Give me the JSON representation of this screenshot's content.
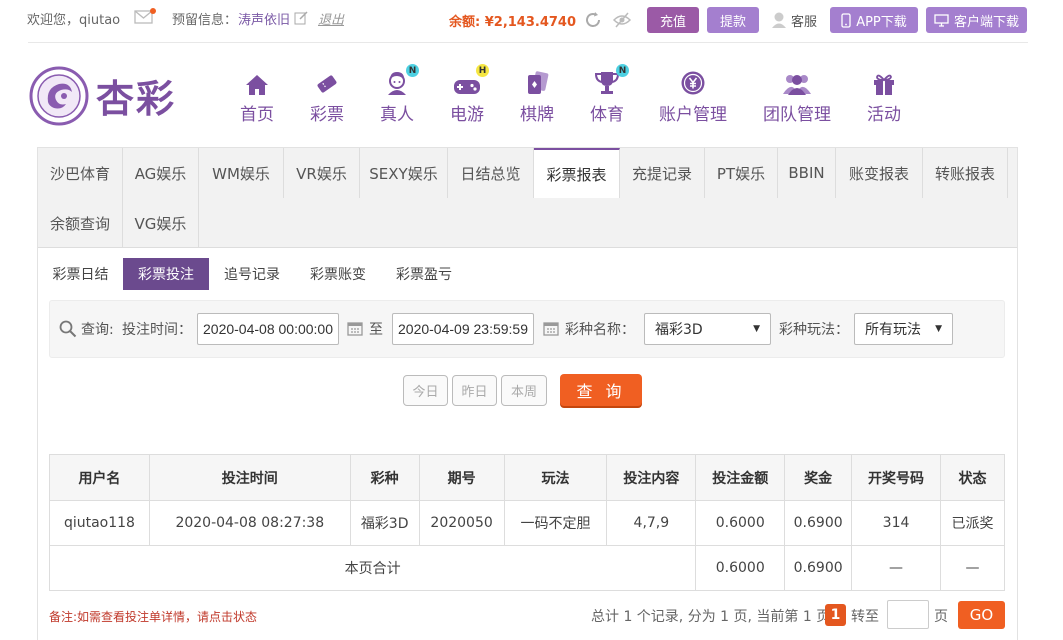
{
  "topbar": {
    "welcome": "欢迎您，qiutao",
    "reserved_label": "预留信息：",
    "reserved_value": "涛声依旧",
    "logout": "退出",
    "balance_label": "余额: ",
    "balance_value": "¥2,143.4740",
    "recharge": "充值",
    "withdraw": "提款",
    "service": "客服",
    "app_download": "APP下载",
    "client_download": "客户端下载"
  },
  "brand": {
    "name": "杏彩"
  },
  "nav": [
    {
      "label": "首页",
      "icon": "home-icon"
    },
    {
      "label": "彩票",
      "icon": "ticket-icon"
    },
    {
      "label": "真人",
      "icon": "live-dealer-icon",
      "badge": "N"
    },
    {
      "label": "电游",
      "icon": "gamepad-icon",
      "badge": "H"
    },
    {
      "label": "棋牌",
      "icon": "cards-icon"
    },
    {
      "label": "体育",
      "icon": "trophy-icon",
      "badge": "N"
    },
    {
      "label": "账户管理",
      "icon": "yen-coin-icon"
    },
    {
      "label": "团队管理",
      "icon": "team-icon"
    },
    {
      "label": "活动",
      "icon": "gift-icon"
    }
  ],
  "report_tabs": [
    "沙巴体育",
    "AG娱乐",
    "WM娱乐",
    "VR娱乐",
    "SEXY娱乐",
    "日结总览",
    "彩票报表",
    "充提记录",
    "PT娱乐",
    "BBIN",
    "账变报表",
    "转账报表",
    "余额查询",
    "VG娱乐"
  ],
  "active_report_tab": "彩票报表",
  "sub_tabs": [
    "彩票日结",
    "彩票投注",
    "追号记录",
    "彩票账变",
    "彩票盈亏"
  ],
  "active_sub_tab": "彩票投注",
  "query": {
    "label": "查询:",
    "bet_time_label": "投注时间：",
    "start": "2020-04-08 00:00:00",
    "to": "至",
    "end": "2020-04-09 23:59:59",
    "lottery_label": "彩种名称：",
    "lottery_value": "福彩3D",
    "play_label": "彩种玩法：",
    "play_value": "所有玩法",
    "today": "今日",
    "yesterday": "昨日",
    "this_week": "本周",
    "submit": "查 询"
  },
  "table": {
    "headers": [
      "用户名",
      "投注时间",
      "彩种",
      "期号",
      "玩法",
      "投注内容",
      "投注金额",
      "奖金",
      "开奖号码",
      "状态"
    ],
    "rows": [
      [
        "qiutao118",
        "2020-04-08 08:27:38",
        "福彩3D",
        "2020050",
        "一码不定胆",
        "4,7,9",
        "0.6000",
        "0.6900",
        "314",
        "已派奖"
      ]
    ],
    "total_label": "本页合计",
    "total_amount": "0.6000",
    "total_bonus": "0.6900",
    "total_dash1": "—",
    "total_dash2": "—"
  },
  "footer": {
    "note": "备注:如需查看投注单详情，请点击状态",
    "summary": "总计 1 个记录, 分为 1 页, 当前第 1 页",
    "current_page": "1",
    "goto": "转至",
    "page_unit": "页",
    "go": "GO"
  },
  "colors": {
    "brand": "#7b4fa0",
    "accent": "#f05f22",
    "balance": "#e4571f"
  }
}
